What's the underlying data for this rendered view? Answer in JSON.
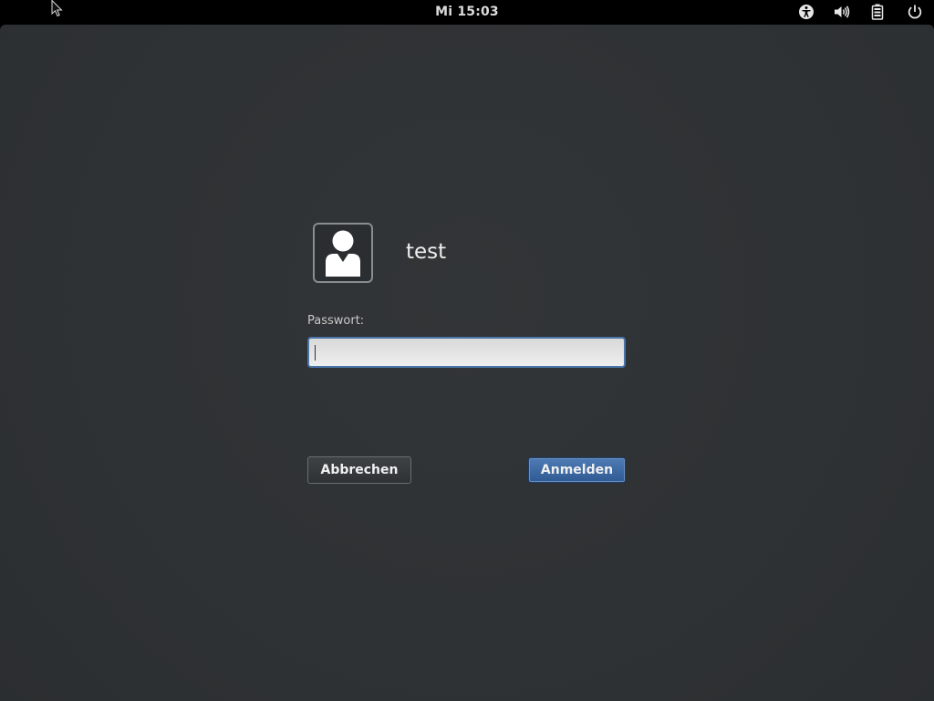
{
  "topbar": {
    "clock": "Mi 15:03",
    "icons": [
      "accessibility-icon",
      "volume-icon",
      "battery-icon",
      "power-icon"
    ]
  },
  "login": {
    "username": "test",
    "password_label": "Passwort:",
    "password_value": "",
    "cancel_label": "Abbrechen",
    "login_label": "Anmelden"
  },
  "colors": {
    "background": "#2f3234",
    "accent": "#3d6aa6",
    "text": "#eeeeec"
  }
}
